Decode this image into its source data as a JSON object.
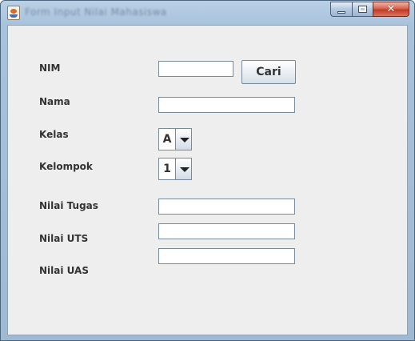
{
  "window": {
    "title": "Form Input Nilai Mahasiswa",
    "controls": {
      "minimize": "minimize",
      "maximize": "maximize",
      "close": "✕"
    }
  },
  "form": {
    "nim": {
      "label": "NIM",
      "value": ""
    },
    "cari_button": "Cari",
    "nama": {
      "label": "Nama",
      "value": ""
    },
    "kelas": {
      "label": "Kelas",
      "selected": "A"
    },
    "kelompok": {
      "label": "Kelompok",
      "selected": "1"
    },
    "nilai_tugas": {
      "label": "Nilai Tugas",
      "value": ""
    },
    "nilai_uts": {
      "label": "Nilai UTS",
      "value": ""
    },
    "nilai_uas": {
      "label": "Nilai UAS",
      "value": ""
    }
  }
}
